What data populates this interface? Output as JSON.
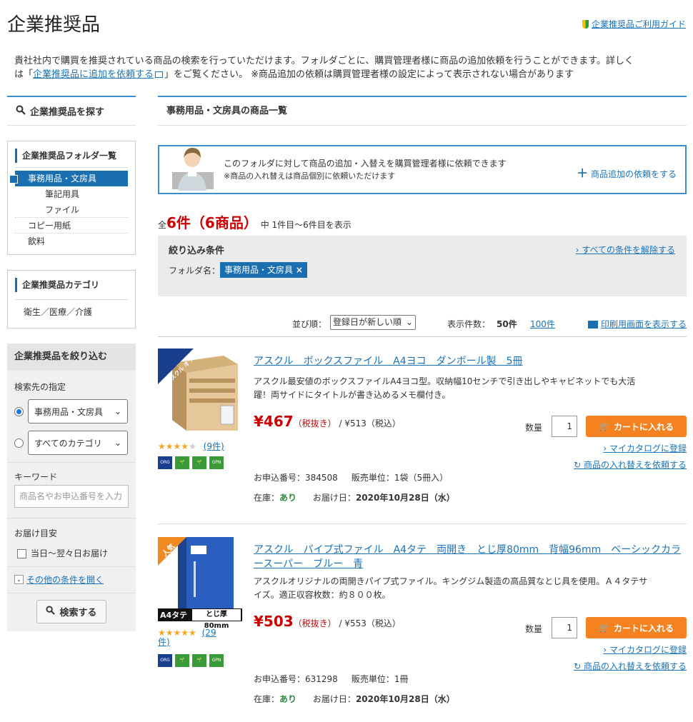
{
  "header": {
    "title": "企業推奨品",
    "guide_link": "企業推奨品ご利用ガイド"
  },
  "intro": {
    "line1": "貴社社内で購買を推奨されている商品の検索を行っていただけます。フォルダごとに、購買管理者様に商品の追加依頼を行うことができます。詳しく",
    "prefix": "は「",
    "link": "企業推奨品に追加を依頼する",
    "suffix": "」をご覧ください。 ※商品追加の依頼は購買管理者様の設定によって表示されない場合があります"
  },
  "sidebar": {
    "search_head": "企業推奨品を探す",
    "folder_title": "企業推奨品フォルダ一覧",
    "folders": [
      "事務用品・文房具",
      "筆記用具",
      "ファイル",
      "コピー用紙",
      "飲料"
    ],
    "category_title": "企業推奨品カテゴリ",
    "category_item": "衛生／医療／介護",
    "narrow_title": "企業推奨品を絞り込む",
    "search_target_label": "検索先の指定",
    "select1": "事務用品・文房具",
    "select2": "すべてのカテゴリ",
    "keyword_label": "キーワード",
    "keyword_placeholder": "商品名やお申込番号を入力",
    "delivery_label": "お届け目安",
    "delivery_option": "当日～翌々日お届け",
    "more_conditions": "その他の条件を開く",
    "search_button": "検索する"
  },
  "main": {
    "heading": "事務用品・文房具の商品一覧",
    "request": {
      "line1": "このフォルダに対して商品の追加・入替えを購買管理者様に依頼できます",
      "line2": "※商品の入れ替えは商品個別に依頼いただけます",
      "link": "商品追加の依頼をする"
    },
    "count": {
      "prefix": "全",
      "big": "6件（6商品）",
      "suffix": "中 1件目～6件目を表示"
    },
    "filter": {
      "title": "絞り込み条件",
      "clear": "すべての条件を解除する",
      "folder_label": "フォルダ名：",
      "tag": "事務用品・文房具"
    },
    "sort": {
      "label": "並び順：",
      "value": "登録日が新しい順",
      "per_page_label": "表示件数：",
      "per_page_current": "50件",
      "per_page_other": "100件",
      "print": "印刷用画面を表示する"
    }
  },
  "products": [
    {
      "ribbon": "アスクル オリジナル",
      "title": "アスクル　ボックスファイル　A4ヨコ　ダンボール製　5冊",
      "desc1": "アスクル最安値のボックスファイルA4ヨコ型。収納幅10センチで引き出しやキャビネットでも大活",
      "desc2": "躍！両サイドにタイトルが書き込めるメモ欄付き。",
      "price": "¥467",
      "tax_ex": "（税抜き）",
      "tax_in": "/ ¥513（税込）",
      "rating": 3.5,
      "reviews": "(9件)",
      "qty_label": "数量",
      "qty": "1",
      "cart": "カートに入れる",
      "mycatalog": "マイカタログに登録",
      "swap": "商品の入れ替えを依頼する",
      "order_no": "お申込番号：384508",
      "unit": "販売単位：1袋（5冊入）",
      "stock_label": "在庫：",
      "stock": "あり",
      "delivery_label": "お届け日：",
      "delivery": "2020年10月28日（水）"
    },
    {
      "ribbon": "人気",
      "img_label_a4": "A4タテ",
      "img_label_width": "とじ厚 80mm",
      "title1": "アスクル　パイプ式ファイル　A4タテ　両開き　とじ厚80mm　背幅96mm　ベーシックカラ",
      "title2": "ースーパー　ブルー　青",
      "desc1": "アスクルオリジナルの両開きパイプ式ファイル。キングジム製造の高品質なとじ具を使用。Ａ４タテサ",
      "desc2": "イズ。適正収容枚数：約８００枚。",
      "price": "¥503",
      "tax_ex": "（税抜き）",
      "tax_in": "/ ¥553（税込）",
      "rating": 4.5,
      "reviews1": "(29",
      "reviews2": "件)",
      "qty_label": "数量",
      "qty": "1",
      "cart": "カートに入れる",
      "mycatalog": "マイカタログに登録",
      "swap": "商品の入れ替えを依頼する",
      "order_no": "お申込番号：631298",
      "unit": "販売単位：1冊",
      "stock_label": "在庫：",
      "stock": "あり",
      "delivery_label": "お届け日：",
      "delivery": "2020年10月28日（水）"
    }
  ],
  "badges": [
    "オリジナル",
    "eco",
    "eco2",
    "GPN"
  ],
  "colors": {
    "accent": "#1a6fb0",
    "price": "#cc0000",
    "cart": "#f58220"
  }
}
